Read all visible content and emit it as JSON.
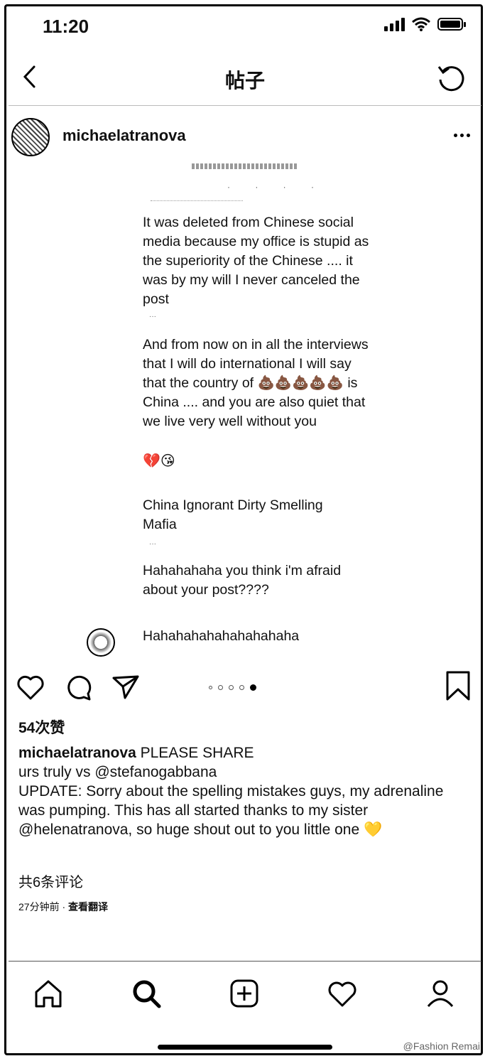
{
  "status_bar": {
    "time": "11:20"
  },
  "nav": {
    "title": "帖子"
  },
  "post": {
    "username": "michaelatranova",
    "messages": [
      "It was deleted from Chinese social media because my office is stupid as the superiority of the Chinese .... it was by my will I never canceled the post",
      "And from now on in all the interviews that I will do international I will say that the country of 💩💩💩💩💩 is China .... and you are also quiet that we live very well without you",
      "China Ignorant Dirty Smelling Mafia",
      "Hahahahaha you think i'm afraid about your post????",
      "Hahahahahahahahahaha"
    ],
    "emoji_line": "💔😘",
    "likes": "54次赞",
    "caption_user": "michaelatranova",
    "caption_line1": "PLEASE SHARE",
    "caption_line2": "urs truly vs @stefanogabbana",
    "caption_line3": "UPDATE: Sorry about the spelling mistakes guys, my adrenaline was pumping. This has all started thanks to my sister @helenatranova, so huge shout out to you little one 💛",
    "comments_link": "共6条评论",
    "time_ago": "27分钟前",
    "separator": " · ",
    "translate": "查看翻译"
  },
  "watermark": "@Fashion Remai",
  "icons": [
    "back-icon",
    "refresh-icon",
    "more-icon",
    "heart-icon",
    "comment-icon",
    "share-icon",
    "bookmark-icon",
    "home-icon",
    "search-icon",
    "add-icon",
    "activity-icon",
    "profile-icon"
  ]
}
